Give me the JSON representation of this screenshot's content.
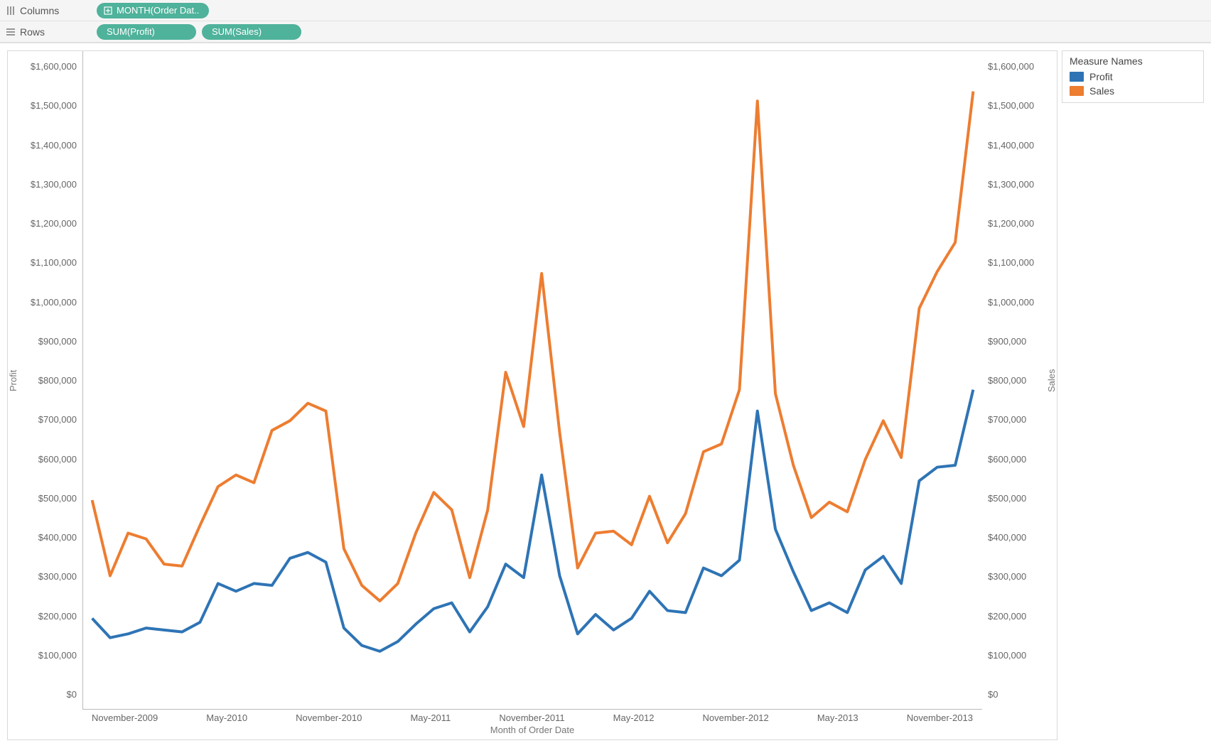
{
  "shelves": {
    "columns_label": "Columns",
    "rows_label": "Rows",
    "columns_pills": [
      {
        "label": "MONTH(Order Dat..",
        "icon": "plus-box"
      }
    ],
    "rows_pills": [
      {
        "label": "SUM(Profit)"
      },
      {
        "label": "SUM(Sales)"
      }
    ]
  },
  "legend": {
    "title": "Measure Names",
    "items": [
      {
        "label": "Profit",
        "color": "#2e74b5"
      },
      {
        "label": "Sales",
        "color": "#ed7d31"
      }
    ]
  },
  "axes": {
    "y_left_title": "Profit",
    "y_right_title": "Sales",
    "x_title": "Month of Order Date",
    "y_ticks": [
      "$1,600,000",
      "$1,500,000",
      "$1,400,000",
      "$1,300,000",
      "$1,200,000",
      "$1,100,000",
      "$1,000,000",
      "$900,000",
      "$800,000",
      "$700,000",
      "$600,000",
      "$500,000",
      "$400,000",
      "$300,000",
      "$200,000",
      "$100,000",
      "$0"
    ],
    "y2_ticks": [
      "$1,600,000",
      "$1,500,000",
      "$1,400,000",
      "$1,300,000",
      "$1,200,000",
      "$1,100,000",
      "$1,000,000",
      "$900,000",
      "$800,000",
      "$700,000",
      "$600,000",
      "$500,000",
      "$400,000",
      "$300,000",
      "$200,000",
      "$100,000",
      "$0"
    ],
    "x_ticks": [
      "November-2009",
      "May-2010",
      "November-2010",
      "May-2011",
      "November-2011",
      "May-2012",
      "November-2012",
      "May-2013",
      "November-2013"
    ]
  },
  "chart_data": {
    "type": "line",
    "xlabel": "Month of Order Date",
    "ylabel_left": "Profit",
    "ylabel_right": "Sales",
    "ylim": [
      0,
      1650000
    ],
    "x_index_start": "2009-11",
    "x_index_end": "2013-12",
    "x": [
      "2009-11",
      "2009-12",
      "2010-01",
      "2010-02",
      "2010-03",
      "2010-04",
      "2010-05",
      "2010-06",
      "2010-07",
      "2010-08",
      "2010-09",
      "2010-10",
      "2010-11",
      "2010-12",
      "2011-01",
      "2011-02",
      "2011-03",
      "2011-04",
      "2011-05",
      "2011-06",
      "2011-07",
      "2011-08",
      "2011-09",
      "2011-10",
      "2011-11",
      "2011-12",
      "2012-01",
      "2012-02",
      "2012-03",
      "2012-04",
      "2012-05",
      "2012-06",
      "2012-07",
      "2012-08",
      "2012-09",
      "2012-10",
      "2012-11",
      "2012-12",
      "2013-01",
      "2013-02",
      "2013-03",
      "2013-04",
      "2013-05",
      "2013-06",
      "2013-07",
      "2013-08",
      "2013-09",
      "2013-10",
      "2013-11",
      "2013-12"
    ],
    "series": [
      {
        "name": "Profit",
        "axis": "left",
        "color": "#2e74b5",
        "values": [
          210000,
          160000,
          170000,
          185000,
          180000,
          175000,
          200000,
          300000,
          280000,
          300000,
          295000,
          365000,
          380000,
          355000,
          185000,
          140000,
          125000,
          150000,
          195000,
          235000,
          250000,
          175000,
          240000,
          350000,
          315000,
          580000,
          320000,
          170000,
          220000,
          180000,
          210000,
          280000,
          230000,
          225000,
          340000,
          320000,
          360000,
          745000,
          440000,
          330000,
          230000,
          250000,
          225000,
          335000,
          370000,
          300000,
          565000,
          600000,
          605000,
          800000
        ]
      },
      {
        "name": "Sales",
        "axis": "right",
        "color": "#ed7d31",
        "values": [
          515000,
          320000,
          430000,
          415000,
          350000,
          345000,
          450000,
          550000,
          580000,
          560000,
          695000,
          720000,
          765000,
          745000,
          390000,
          295000,
          255000,
          300000,
          430000,
          535000,
          490000,
          315000,
          490000,
          845000,
          705000,
          1100000,
          690000,
          340000,
          430000,
          435000,
          400000,
          525000,
          405000,
          480000,
          640000,
          660000,
          800000,
          1545000,
          790000,
          605000,
          470000,
          510000,
          485000,
          620000,
          720000,
          625000,
          1010000,
          1105000,
          1180000,
          1570000
        ]
      }
    ]
  }
}
